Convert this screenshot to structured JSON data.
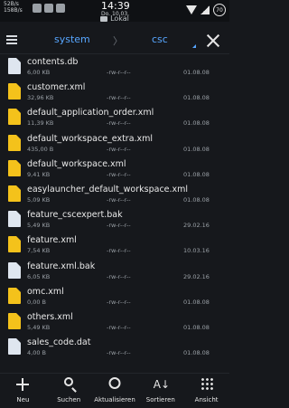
{
  "statusbar": {
    "speed_up": "52B/s",
    "speed_down": "158B/s",
    "time": "14:39",
    "date": "Do. 10.03.",
    "battery": "70"
  },
  "location": {
    "label": "Lokal"
  },
  "toolbar": {
    "crumb_1": "system",
    "separator": "〉",
    "crumb_2": "csc"
  },
  "files": [
    {
      "name": "contents.db",
      "size": "6,00 KB",
      "perm": "-rw-r--r--",
      "date": "01.08.08",
      "icon": "doc"
    },
    {
      "name": "customer.xml",
      "size": "32,96 KB",
      "perm": "-rw-r--r--",
      "date": "01.08.08",
      "icon": "xml"
    },
    {
      "name": "default_application_order.xml",
      "size": "11,39 KB",
      "perm": "-rw-r--r--",
      "date": "01.08.08",
      "icon": "xml"
    },
    {
      "name": "default_workspace_extra.xml",
      "size": "435,00 B",
      "perm": "-rw-r--r--",
      "date": "01.08.08",
      "icon": "xml"
    },
    {
      "name": "default_workspace.xml",
      "size": "9,41 KB",
      "perm": "-rw-r--r--",
      "date": "01.08.08",
      "icon": "xml"
    },
    {
      "name": "easylauncher_default_workspace.xml",
      "size": "5,09 KB",
      "perm": "-rw-r--r--",
      "date": "01.08.08",
      "icon": "xml"
    },
    {
      "name": "feature_cscexpert.bak",
      "size": "5,49 KB",
      "perm": "-rw-r--r--",
      "date": "29.02.16",
      "icon": "doc"
    },
    {
      "name": "feature.xml",
      "size": "7,54 KB",
      "perm": "-rw-r--r--",
      "date": "10.03.16",
      "icon": "xml"
    },
    {
      "name": "feature.xml.bak",
      "size": "6,05 KB",
      "perm": "-rw-r--r--",
      "date": "29.02.16",
      "icon": "doc"
    },
    {
      "name": "omc.xml",
      "size": "0,00 B",
      "perm": "-rw-r--r--",
      "date": "01.08.08",
      "icon": "xml"
    },
    {
      "name": "others.xml",
      "size": "5,49 KB",
      "perm": "-rw-r--r--",
      "date": "01.08.08",
      "icon": "xml"
    },
    {
      "name": "sales_code.dat",
      "size": "4,00 B",
      "perm": "-rw-r--r--",
      "date": "01.08.08",
      "icon": "doc"
    }
  ],
  "bottombar": {
    "new": "Neu",
    "search": "Suchen",
    "refresh": "Aktualisieren",
    "sort": "Sortieren",
    "view": "Ansicht"
  },
  "colors": {
    "accent": "#57a6ff",
    "xml_icon": "#f4c21b",
    "doc_icon": "#dfe6ef",
    "background": "#16181c"
  }
}
